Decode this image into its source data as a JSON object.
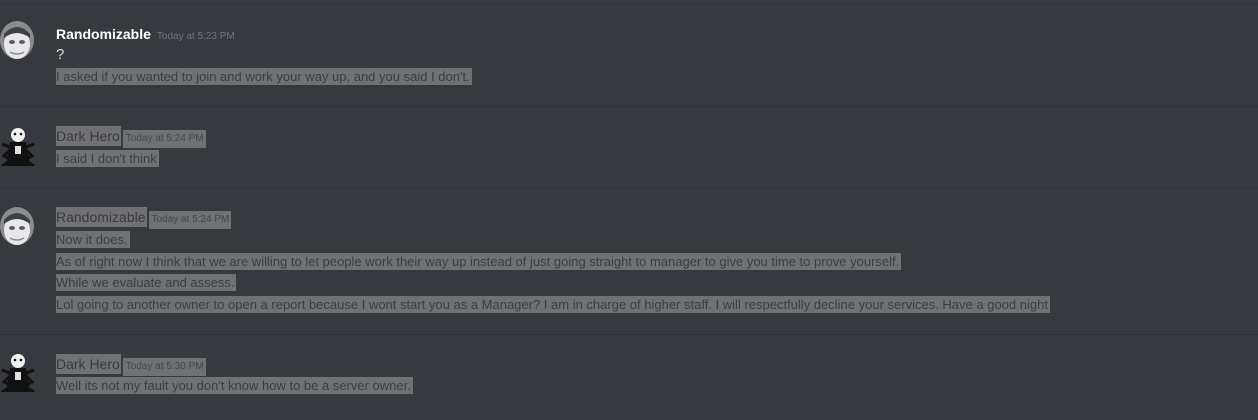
{
  "messages": [
    {
      "username": "Randomizable",
      "timestamp": "Today at 5:23 PM",
      "lines": [
        "?",
        "I asked if you wanted to join and work your way up, and you said I don't."
      ]
    },
    {
      "username": "Dark Hero",
      "timestamp": "Today at 5:24 PM",
      "lines": [
        "I said I don't think"
      ]
    },
    {
      "username": "Randomizable",
      "timestamp": "Today at 5:24 PM",
      "lines": [
        "Now it does.",
        "As of right now I think that we are willing to let people work their way up instead of just going straight to manager to give you time to prove yourself.",
        "While we evaluate and assess.",
        "Lol going to another owner to open a report because I wont start you as a Manager? I am in charge of higher staff. I will respectfully decline your services. Have a good night"
      ]
    },
    {
      "username": "Dark Hero",
      "timestamp": "Today at 5:30 PM",
      "lines": [
        "Well its not my fault you don't know how to be a server owner."
      ]
    }
  ]
}
